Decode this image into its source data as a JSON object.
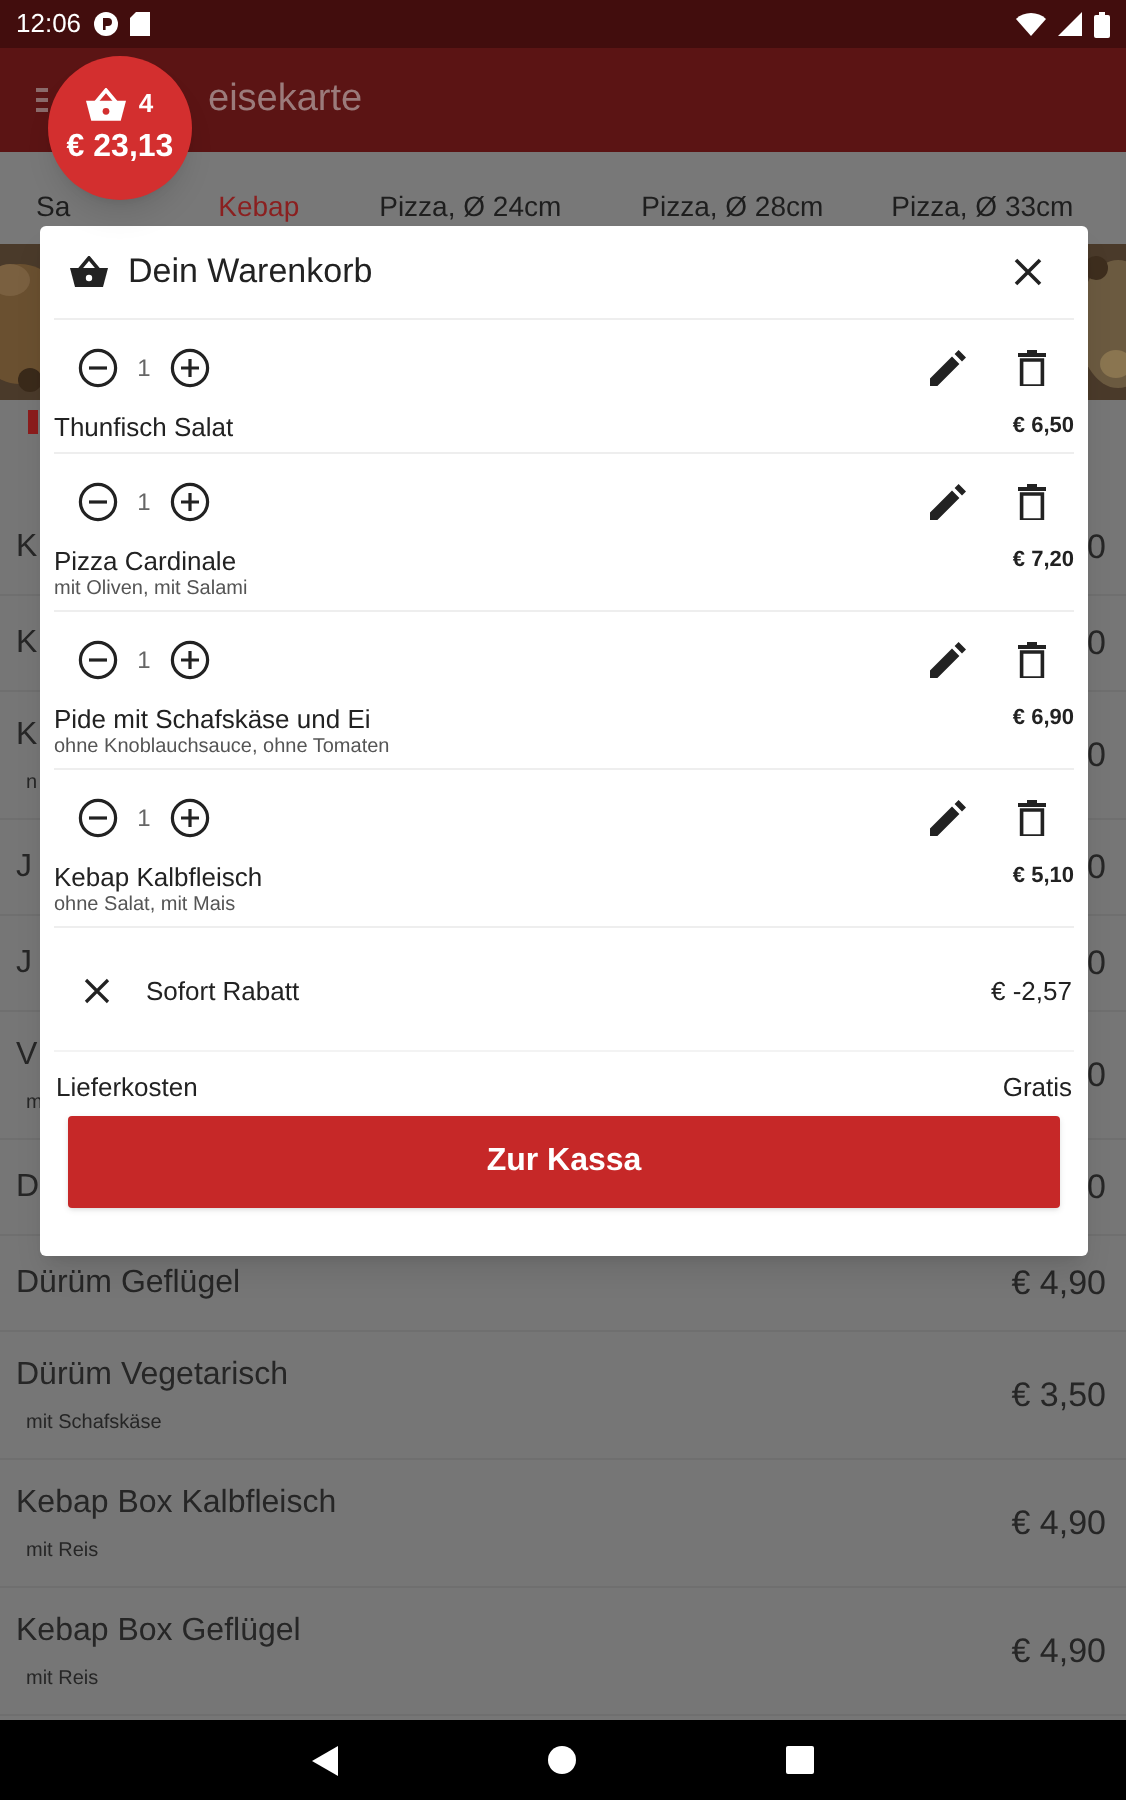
{
  "status_bar": {
    "time": "12:06"
  },
  "app_bar": {
    "title": "eisekarte"
  },
  "cart_badge": {
    "count": "4",
    "total": "€ 23,13"
  },
  "tabs": [
    {
      "label": "Sa",
      "selected": false
    },
    {
      "label": "Kebap",
      "selected": true
    },
    {
      "label": "Pizza, Ø 24cm",
      "selected": false
    },
    {
      "label": "Pizza, Ø 28cm",
      "selected": false
    },
    {
      "label": "Pizza, Ø 33cm",
      "selected": false
    }
  ],
  "menu_items": [
    {
      "name": "K",
      "price": "0"
    },
    {
      "name": "K",
      "price": "0"
    },
    {
      "name": "K",
      "note": "n",
      "price": "0"
    },
    {
      "name": "J",
      "price": "0"
    },
    {
      "name": "J",
      "price": "0"
    },
    {
      "name": "V",
      "note": "m",
      "price": "0"
    },
    {
      "name": "D",
      "price": "0"
    },
    {
      "name": "Dürüm Geflügel",
      "price": "€ 4,90"
    },
    {
      "name": "Dürüm Vegetarisch",
      "note": "mit Schafskäse",
      "price": "€ 3,50"
    },
    {
      "name": "Kebap Box Kalbfleisch",
      "note": "mit Reis",
      "price": "€ 4,90"
    },
    {
      "name": "Kebap Box Geflügel",
      "note": "mit Reis",
      "price": "€ 4,90"
    }
  ],
  "cart": {
    "title": "Dein Warenkorb",
    "items": [
      {
        "quantity": "1",
        "name": "Thunfisch Salat",
        "price": "€ 6,50"
      },
      {
        "quantity": "1",
        "name": "Pizza Cardinale",
        "options": "mit Oliven, mit Salami",
        "price": "€ 7,20"
      },
      {
        "quantity": "1",
        "name": "Pide mit Schafskäse und Ei",
        "options": "ohne Knoblauchsauce, ohne Tomaten",
        "price": "€ 6,90"
      },
      {
        "quantity": "1",
        "name": "Kebap Kalbfleisch",
        "options": "ohne Salat, mit Mais",
        "price": "€ 5,10"
      }
    ],
    "discount": {
      "label": "Sofort Rabatt",
      "amount": "€ -2,57"
    },
    "delivery": {
      "label": "Lieferkosten",
      "value": "Gratis"
    },
    "checkout_button": "Zur Kassa"
  }
}
